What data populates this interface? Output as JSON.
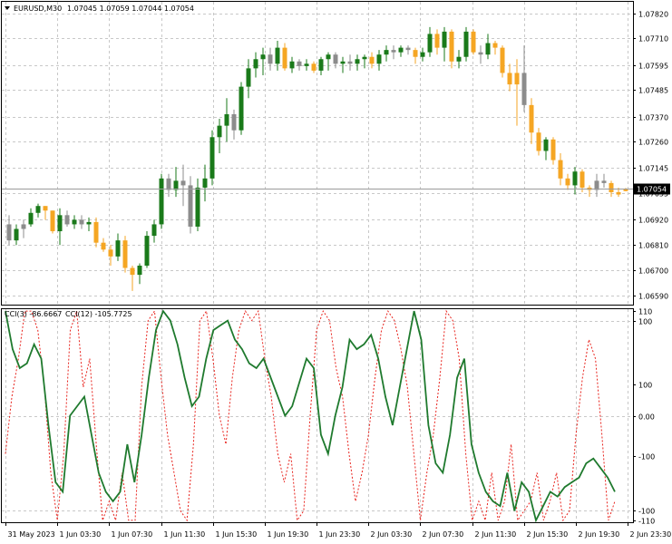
{
  "window": {
    "symbol_label": "EURUSD,M30",
    "ohlc_label": "1.07045 1.07059 1.07044 1.07054"
  },
  "indicator": {
    "label_cci3": "CCI(3) -86.6667",
    "label_cci12": "CCI(12) -105.7725"
  },
  "colors": {
    "background": "#ffffff",
    "grid": "#c8c8c8",
    "bull_candle": "#1a7a1a",
    "bear_candle": "#f5a623",
    "neutral_candle": "#8c8c8c",
    "cci3_line": "#e8231d",
    "cci12_line": "#1f7a2e",
    "price_tag_bg": "#000000",
    "price_tag_text": "#ffffff"
  },
  "chart_data": [
    {
      "type": "candlestick",
      "title": "EURUSD,M30",
      "ylim": [
        1.0655,
        1.0787
      ],
      "y_ticks": [
        "1.07820",
        "1.07710",
        "1.07595",
        "1.07485",
        "1.07370",
        "1.07260",
        "1.07145",
        "1.07035",
        "1.06920",
        "1.06810",
        "1.06700",
        "1.06590"
      ],
      "current_price_label": "1.07054",
      "grid": true,
      "candles": [
        {
          "o": 1.069,
          "h": 1.0694,
          "l": 1.0681,
          "c": 1.0683
        },
        {
          "o": 1.0683,
          "h": 1.069,
          "l": 1.0681,
          "c": 1.0688
        },
        {
          "o": 1.0688,
          "h": 1.0692,
          "l": 1.0684,
          "c": 1.069
        },
        {
          "o": 1.069,
          "h": 1.0697,
          "l": 1.0689,
          "c": 1.0695
        },
        {
          "o": 1.0695,
          "h": 1.0699,
          "l": 1.0693,
          "c": 1.0698
        },
        {
          "o": 1.0698,
          "h": 1.0698,
          "l": 1.0692,
          "c": 1.0696
        },
        {
          "o": 1.0696,
          "h": 1.0696,
          "l": 1.0686,
          "c": 1.0687
        },
        {
          "o": 1.0687,
          "h": 1.0697,
          "l": 1.0681,
          "c": 1.0694
        },
        {
          "o": 1.0694,
          "h": 1.0696,
          "l": 1.0689,
          "c": 1.069
        },
        {
          "o": 1.069,
          "h": 1.0694,
          "l": 1.0688,
          "c": 1.0692
        },
        {
          "o": 1.0692,
          "h": 1.0694,
          "l": 1.0688,
          "c": 1.069
        },
        {
          "o": 1.069,
          "h": 1.0693,
          "l": 1.0687,
          "c": 1.0691
        },
        {
          "o": 1.0691,
          "h": 1.0693,
          "l": 1.068,
          "c": 1.0682
        },
        {
          "o": 1.0682,
          "h": 1.0684,
          "l": 1.0678,
          "c": 1.0679
        },
        {
          "o": 1.0679,
          "h": 1.0681,
          "l": 1.0672,
          "c": 1.0676
        },
        {
          "o": 1.0676,
          "h": 1.0686,
          "l": 1.0674,
          "c": 1.0683
        },
        {
          "o": 1.0683,
          "h": 1.0685,
          "l": 1.0669,
          "c": 1.0671
        },
        {
          "o": 1.0671,
          "h": 1.0672,
          "l": 1.0661,
          "c": 1.0668
        },
        {
          "o": 1.0668,
          "h": 1.0673,
          "l": 1.0664,
          "c": 1.0672
        },
        {
          "o": 1.0672,
          "h": 1.0687,
          "l": 1.0671,
          "c": 1.0685
        },
        {
          "o": 1.0685,
          "h": 1.0692,
          "l": 1.0682,
          "c": 1.069
        },
        {
          "o": 1.069,
          "h": 1.0712,
          "l": 1.0688,
          "c": 1.071
        },
        {
          "o": 1.071,
          "h": 1.0712,
          "l": 1.0702,
          "c": 1.0705
        },
        {
          "o": 1.0705,
          "h": 1.0715,
          "l": 1.0702,
          "c": 1.0709
        },
        {
          "o": 1.0709,
          "h": 1.0716,
          "l": 1.0698,
          "c": 1.0707
        },
        {
          "o": 1.0707,
          "h": 1.0711,
          "l": 1.0686,
          "c": 1.0689
        },
        {
          "o": 1.0689,
          "h": 1.071,
          "l": 1.0687,
          "c": 1.0706
        },
        {
          "o": 1.0706,
          "h": 1.0716,
          "l": 1.07,
          "c": 1.071
        },
        {
          "o": 1.071,
          "h": 1.0731,
          "l": 1.0707,
          "c": 1.0728
        },
        {
          "o": 1.0728,
          "h": 1.0736,
          "l": 1.0721,
          "c": 1.0733
        },
        {
          "o": 1.0733,
          "h": 1.0745,
          "l": 1.0726,
          "c": 1.0738
        },
        {
          "o": 1.0738,
          "h": 1.074,
          "l": 1.0727,
          "c": 1.0731
        },
        {
          "o": 1.0731,
          "h": 1.0752,
          "l": 1.0729,
          "c": 1.075
        },
        {
          "o": 1.075,
          "h": 1.0762,
          "l": 1.0745,
          "c": 1.0758
        },
        {
          "o": 1.0758,
          "h": 1.0765,
          "l": 1.0754,
          "c": 1.0762
        },
        {
          "o": 1.0762,
          "h": 1.0767,
          "l": 1.0755,
          "c": 1.0764
        },
        {
          "o": 1.0764,
          "h": 1.0767,
          "l": 1.0757,
          "c": 1.076
        },
        {
          "o": 1.076,
          "h": 1.077,
          "l": 1.0757,
          "c": 1.0767
        },
        {
          "o": 1.0767,
          "h": 1.0769,
          "l": 1.0757,
          "c": 1.0758
        },
        {
          "o": 1.0758,
          "h": 1.0763,
          "l": 1.0756,
          "c": 1.0761
        },
        {
          "o": 1.0761,
          "h": 1.0762,
          "l": 1.0757,
          "c": 1.0759
        },
        {
          "o": 1.0759,
          "h": 1.0762,
          "l": 1.0757,
          "c": 1.076
        },
        {
          "o": 1.076,
          "h": 1.0761,
          "l": 1.0756,
          "c": 1.0757
        },
        {
          "o": 1.0757,
          "h": 1.0763,
          "l": 1.0755,
          "c": 1.0762
        },
        {
          "o": 1.0762,
          "h": 1.0765,
          "l": 1.0757,
          "c": 1.0764
        },
        {
          "o": 1.0764,
          "h": 1.0765,
          "l": 1.0758,
          "c": 1.076
        },
        {
          "o": 1.076,
          "h": 1.0763,
          "l": 1.0756,
          "c": 1.0761
        },
        {
          "o": 1.0761,
          "h": 1.0764,
          "l": 1.0757,
          "c": 1.076
        },
        {
          "o": 1.076,
          "h": 1.0764,
          "l": 1.0757,
          "c": 1.0762
        },
        {
          "o": 1.0762,
          "h": 1.0764,
          "l": 1.0758,
          "c": 1.0763
        },
        {
          "o": 1.0763,
          "h": 1.0765,
          "l": 1.0758,
          "c": 1.076
        },
        {
          "o": 1.076,
          "h": 1.0766,
          "l": 1.0757,
          "c": 1.0764
        },
        {
          "o": 1.0764,
          "h": 1.0768,
          "l": 1.0761,
          "c": 1.0766
        },
        {
          "o": 1.0766,
          "h": 1.0768,
          "l": 1.0762,
          "c": 1.0765
        },
        {
          "o": 1.0765,
          "h": 1.0768,
          "l": 1.0763,
          "c": 1.0767
        },
        {
          "o": 1.0767,
          "h": 1.0768,
          "l": 1.0764,
          "c": 1.0766
        },
        {
          "o": 1.0766,
          "h": 1.0767,
          "l": 1.076,
          "c": 1.0763
        },
        {
          "o": 1.0763,
          "h": 1.0767,
          "l": 1.0761,
          "c": 1.0765
        },
        {
          "o": 1.0765,
          "h": 1.0776,
          "l": 1.0763,
          "c": 1.0773
        },
        {
          "o": 1.0773,
          "h": 1.0775,
          "l": 1.0764,
          "c": 1.0767
        },
        {
          "o": 1.0767,
          "h": 1.0776,
          "l": 1.0761,
          "c": 1.0774
        },
        {
          "o": 1.0774,
          "h": 1.0775,
          "l": 1.0758,
          "c": 1.0761
        },
        {
          "o": 1.0761,
          "h": 1.0766,
          "l": 1.0758,
          "c": 1.0763
        },
        {
          "o": 1.0763,
          "h": 1.0776,
          "l": 1.0761,
          "c": 1.0774
        },
        {
          "o": 1.0774,
          "h": 1.0775,
          "l": 1.0764,
          "c": 1.0765
        },
        {
          "o": 1.0765,
          "h": 1.0768,
          "l": 1.076,
          "c": 1.0764
        },
        {
          "o": 1.0764,
          "h": 1.0773,
          "l": 1.0762,
          "c": 1.0769
        },
        {
          "o": 1.0769,
          "h": 1.077,
          "l": 1.0764,
          "c": 1.0767
        },
        {
          "o": 1.0767,
          "h": 1.0768,
          "l": 1.0754,
          "c": 1.0756
        },
        {
          "o": 1.0756,
          "h": 1.076,
          "l": 1.0748,
          "c": 1.0751
        },
        {
          "o": 1.0751,
          "h": 1.0762,
          "l": 1.0733,
          "c": 1.0756
        },
        {
          "o": 1.0756,
          "h": 1.0768,
          "l": 1.0739,
          "c": 1.0742
        },
        {
          "o": 1.0742,
          "h": 1.0745,
          "l": 1.0725,
          "c": 1.073
        },
        {
          "o": 1.073,
          "h": 1.0732,
          "l": 1.072,
          "c": 1.0722
        },
        {
          "o": 1.0722,
          "h": 1.0728,
          "l": 1.0718,
          "c": 1.0727
        },
        {
          "o": 1.0727,
          "h": 1.0728,
          "l": 1.0716,
          "c": 1.0718
        },
        {
          "o": 1.0718,
          "h": 1.0721,
          "l": 1.0707,
          "c": 1.071
        },
        {
          "o": 1.071,
          "h": 1.0712,
          "l": 1.0705,
          "c": 1.0707
        },
        {
          "o": 1.0707,
          "h": 1.0715,
          "l": 1.0703,
          "c": 1.0713
        },
        {
          "o": 1.0713,
          "h": 1.0714,
          "l": 1.0704,
          "c": 1.0706
        },
        {
          "o": 1.0706,
          "h": 1.0707,
          "l": 1.0702,
          "c": 1.0705
        },
        {
          "o": 1.0705,
          "h": 1.0712,
          "l": 1.0702,
          "c": 1.0709
        },
        {
          "o": 1.0709,
          "h": 1.0712,
          "l": 1.0706,
          "c": 1.0708
        },
        {
          "o": 1.0708,
          "h": 1.0709,
          "l": 1.0702,
          "c": 1.0704
        },
        {
          "o": 1.0704,
          "h": 1.0706,
          "l": 1.0702,
          "c": 1.0703
        },
        {
          "o": 1.07045,
          "h": 1.07059,
          "l": 1.07044,
          "c": 1.07054
        }
      ],
      "candle_colors": [
        "gray",
        "green",
        "gray",
        "green",
        "green",
        "orange",
        "orange",
        "green",
        "gray",
        "green",
        "gray",
        "green",
        "orange",
        "orange",
        "orange",
        "green",
        "orange",
        "orange",
        "green",
        "green",
        "green",
        "green",
        "gray",
        "green",
        "gray",
        "gray",
        "green",
        "green",
        "green",
        "green",
        "green",
        "gray",
        "green",
        "green",
        "green",
        "green",
        "gray",
        "green",
        "orange",
        "green",
        "gray",
        "green",
        "orange",
        "green",
        "green",
        "gray",
        "green",
        "gray",
        "green",
        "green",
        "orange",
        "green",
        "green",
        "gray",
        "green",
        "gray",
        "orange",
        "green",
        "green",
        "orange",
        "green",
        "orange",
        "green",
        "green",
        "orange",
        "gray",
        "green",
        "orange",
        "orange",
        "orange",
        "orange",
        "gray",
        "orange",
        "orange",
        "green",
        "orange",
        "orange",
        "orange",
        "green",
        "orange",
        "orange",
        "gray",
        "gray",
        "orange",
        "orange",
        "orange"
      ]
    },
    {
      "type": "line",
      "title": "CCI(3) -86.6667  CCI(12) -105.7725",
      "ylim": [
        -112,
        112
      ],
      "y_ticks": [
        "110",
        "100",
        "100",
        "0.00",
        "-100",
        "-100",
        "-110"
      ],
      "grid": true,
      "series": [
        {
          "name": "CCI(3)",
          "style": "dotted",
          "values": [
            -40,
            20,
            60,
            110,
            110,
            90,
            30,
            -60,
            -110,
            -40,
            90,
            110,
            30,
            60,
            -30,
            -110,
            -90,
            -110,
            -60,
            -110,
            -110,
            30,
            100,
            110,
            40,
            -20,
            -60,
            -100,
            -110,
            -30,
            100,
            110,
            60,
            0,
            -30,
            40,
            90,
            110,
            100,
            110,
            60,
            20,
            -40,
            -70,
            -40,
            -110,
            -100,
            0,
            90,
            110,
            100,
            50,
            20,
            -40,
            -90,
            -60,
            -20,
            40,
            90,
            110,
            100,
            70,
            30,
            -40,
            -110,
            -60,
            -20,
            40,
            110,
            100,
            60,
            -40,
            -110,
            -90,
            -110,
            -60,
            -110,
            -90,
            -30,
            -110,
            -100,
            -90,
            -60,
            -110,
            -90,
            -60,
            -110,
            -100,
            -20,
            40,
            80,
            60,
            -20,
            -110,
            -90
          ]
        },
        {
          "name": "CCI(12)",
          "style": "solid",
          "values": [
            110,
            70,
            50,
            55,
            75,
            60,
            -10,
            -70,
            -80,
            0,
            10,
            20,
            -20,
            -60,
            -80,
            -90,
            -80,
            -30,
            -70,
            -20,
            40,
            90,
            110,
            100,
            75,
            40,
            10,
            20,
            60,
            90,
            95,
            100,
            80,
            70,
            55,
            50,
            60,
            40,
            20,
            0,
            10,
            35,
            60,
            50,
            -20,
            -40,
            0,
            30,
            80,
            70,
            75,
            85,
            60,
            20,
            -10,
            30,
            70,
            110,
            80,
            -10,
            -50,
            -60,
            -20,
            40,
            60,
            -30,
            -60,
            -80,
            -90,
            -95,
            -60,
            -100,
            -70,
            -80,
            -110,
            -95,
            -80,
            -85,
            -75,
            -70,
            -65,
            -50,
            -45,
            -55,
            -65,
            -80
          ]
        }
      ],
      "x_ticks": [
        "31 May 2023",
        "1 Jun 03:30",
        "1 Jun 07:30",
        "1 Jun 11:30",
        "1 Jun 15:30",
        "1 Jun 19:30",
        "1 Jun 23:30",
        "2 Jun 03:30",
        "2 Jun 07:30",
        "2 Jun 11:30",
        "2 Jun 15:30",
        "2 Jun 19:30",
        "2 Jun 23:30"
      ]
    }
  ]
}
